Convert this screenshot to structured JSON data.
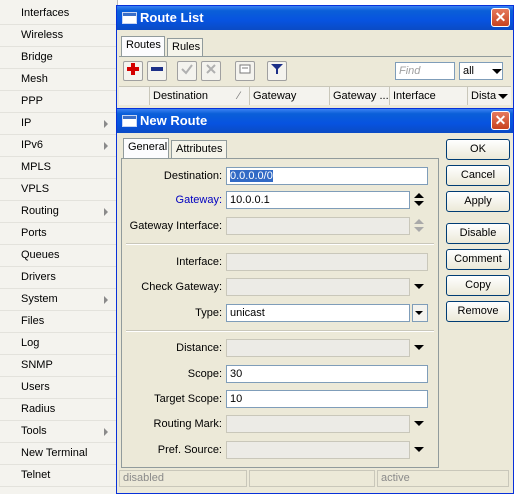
{
  "menu": {
    "items": [
      {
        "label": "Interfaces",
        "submenu": false
      },
      {
        "label": "Wireless",
        "submenu": false
      },
      {
        "label": "Bridge",
        "submenu": false
      },
      {
        "label": "Mesh",
        "submenu": false
      },
      {
        "label": "PPP",
        "submenu": false
      },
      {
        "label": "IP",
        "submenu": true
      },
      {
        "label": "IPv6",
        "submenu": true
      },
      {
        "label": "MPLS",
        "submenu": false
      },
      {
        "label": "VPLS",
        "submenu": false
      },
      {
        "label": "Routing",
        "submenu": true
      },
      {
        "label": "Ports",
        "submenu": false
      },
      {
        "label": "Queues",
        "submenu": false
      },
      {
        "label": "Drivers",
        "submenu": false
      },
      {
        "label": "System",
        "submenu": true
      },
      {
        "label": "Files",
        "submenu": false
      },
      {
        "label": "Log",
        "submenu": false
      },
      {
        "label": "SNMP",
        "submenu": false
      },
      {
        "label": "Users",
        "submenu": false
      },
      {
        "label": "Radius",
        "submenu": false
      },
      {
        "label": "Tools",
        "submenu": true
      },
      {
        "label": "New Terminal",
        "submenu": false
      },
      {
        "label": "Telnet",
        "submenu": false
      }
    ]
  },
  "route_list": {
    "title": "Route List",
    "close": "✕",
    "tabs": [
      "Routes",
      "Rules"
    ],
    "find_placeholder": "Find",
    "filter_value": "all",
    "columns": [
      "Destination",
      "Gateway",
      "Gateway ...",
      "Interface",
      "Dista"
    ]
  },
  "new_route": {
    "title": "New Route",
    "close": "✕",
    "tabs": [
      "General",
      "Attributes"
    ],
    "fields": {
      "destination": {
        "label": "Destination:",
        "value": "0.0.0.0/0"
      },
      "gateway": {
        "label": "Gateway:",
        "value": "10.0.0.1"
      },
      "gateway_interface": {
        "label": "Gateway Interface:",
        "value": ""
      },
      "interface": {
        "label": "Interface:",
        "value": ""
      },
      "check_gateway": {
        "label": "Check Gateway:",
        "value": ""
      },
      "type": {
        "label": "Type:",
        "value": "unicast"
      },
      "distance": {
        "label": "Distance:",
        "value": ""
      },
      "scope": {
        "label": "Scope:",
        "value": "30"
      },
      "target_scope": {
        "label": "Target Scope:",
        "value": "10"
      },
      "routing_mark": {
        "label": "Routing Mark:",
        "value": ""
      },
      "pref_source": {
        "label": "Pref. Source:",
        "value": ""
      }
    },
    "buttons": {
      "ok": "OK",
      "cancel": "Cancel",
      "apply": "Apply",
      "disable": "Disable",
      "comment": "Comment",
      "copy": "Copy",
      "remove": "Remove"
    },
    "status": {
      "left": "disabled",
      "right": "active"
    }
  },
  "colors": {
    "titlebar": "#0a5fd8",
    "window_bg": "#ece9d8",
    "gateway_label": "#0000c0",
    "selection": "#316ac5",
    "add_icon": "#d40000",
    "remove_icon": "#1c2f88"
  }
}
